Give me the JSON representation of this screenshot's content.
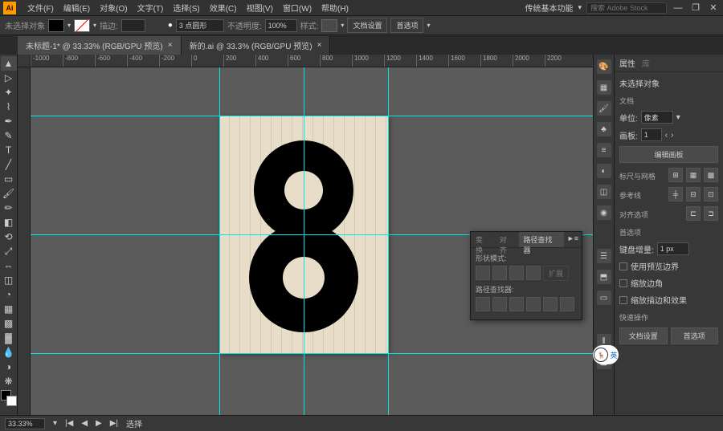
{
  "app": {
    "logo": "Ai"
  },
  "menu": [
    "文件(F)",
    "编辑(E)",
    "对象(O)",
    "文字(T)",
    "选择(S)",
    "效果(C)",
    "视图(V)",
    "窗口(W)",
    "帮助(H)"
  ],
  "menubar_right": {
    "workspace": "传统基本功能",
    "search_placeholder": "搜索 Adobe Stock"
  },
  "optbar": {
    "no_selection": "未选择对象",
    "stroke_label": "描边:",
    "stroke_val": "",
    "stroke_style": "3 点圆形",
    "opacity_label": "不透明度:",
    "opacity_val": "100%",
    "style_label": "样式:",
    "doc_setup": "文档设置",
    "prefs": "首选项"
  },
  "tabs": [
    {
      "label": "未标题-1* @ 33.33% (RGB/GPU 预览)",
      "active": true
    },
    {
      "label": "新的.ai @ 33.3% (RGB/GPU 预览)",
      "active": false
    }
  ],
  "ruler_marks": [
    "-1000",
    "-800",
    "-600",
    "-400",
    "-200",
    "0",
    "200",
    "400",
    "600",
    "800",
    "1000",
    "1200",
    "1400",
    "1600",
    "1800",
    "2000",
    "2200"
  ],
  "artboard": {
    "glyph": "8"
  },
  "float": {
    "tabs": [
      "变换",
      "对齐",
      "路径查找器"
    ],
    "shape_mode": "形状模式:",
    "pathfinder": "路径查找器:",
    "expand": "扩展"
  },
  "props": {
    "tab1": "属性",
    "tab2": "库",
    "no_sel": "未选择对象",
    "doc": "文档",
    "unit_label": "单位:",
    "unit_val": "像素",
    "artboard_label": "画板:",
    "artboard_val": "1",
    "edit_artboard": "编辑画板",
    "ruler_grid": "标尺与网格",
    "guides": "参考线",
    "align_opts": "对齐选项",
    "prefs": "首选项",
    "key_inc_label": "键盘增量:",
    "key_inc_val": "1 px",
    "chk1": "使用预览边界",
    "chk2": "缩放边角",
    "chk3": "缩放描边和效果",
    "quick": "快速操作",
    "doc_setup_btn": "文档设置",
    "prefs_btn": "首选项"
  },
  "status": {
    "zoom": "33.33%",
    "tool": "选择"
  },
  "avatar": {
    "badge": "英"
  }
}
